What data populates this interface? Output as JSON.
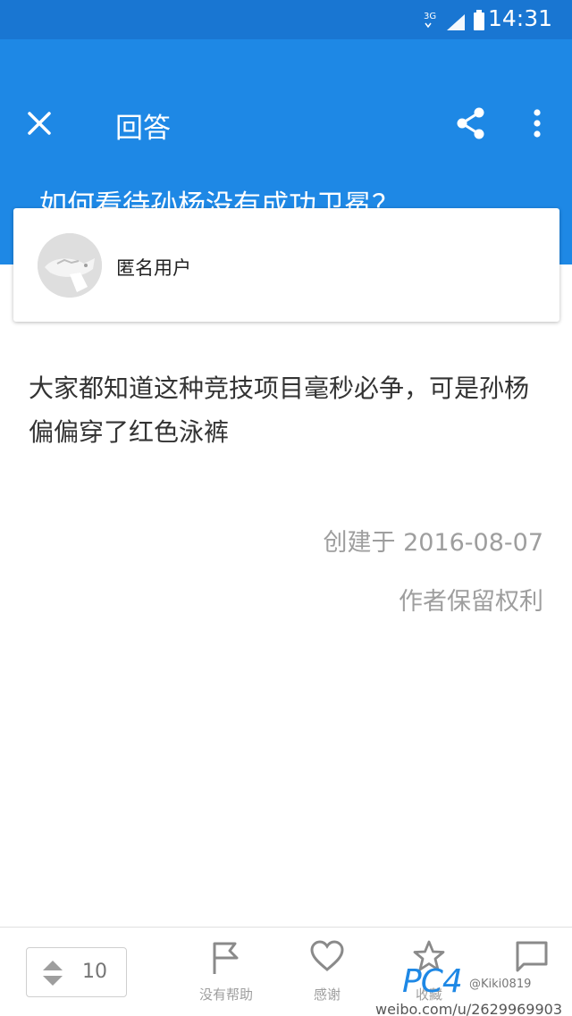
{
  "status_bar": {
    "network": "3G",
    "time": "14:31"
  },
  "app_bar": {
    "title": "回答"
  },
  "question": {
    "title": "如何看待孙杨没有成功卫冕？"
  },
  "author": {
    "name": "匿名用户"
  },
  "answer": {
    "text": "大家都知道这种竞技项目毫秒必争，可是孙杨偏偏穿了红色泳裤"
  },
  "meta": {
    "created": "创建于 2016-08-07",
    "rights": "作者保留权利"
  },
  "bottom_bar": {
    "vote_count": "10",
    "not_helpful_label": "没有帮助",
    "thanks_label": "感谢",
    "collect_label": "收藏"
  },
  "watermark": {
    "logo": "PC4",
    "logo_sub": "@Kiki0819",
    "url": "weibo.com/u/2629969903"
  },
  "colors": {
    "primary": "#1e88e5",
    "status_bar": "#1976d2"
  }
}
